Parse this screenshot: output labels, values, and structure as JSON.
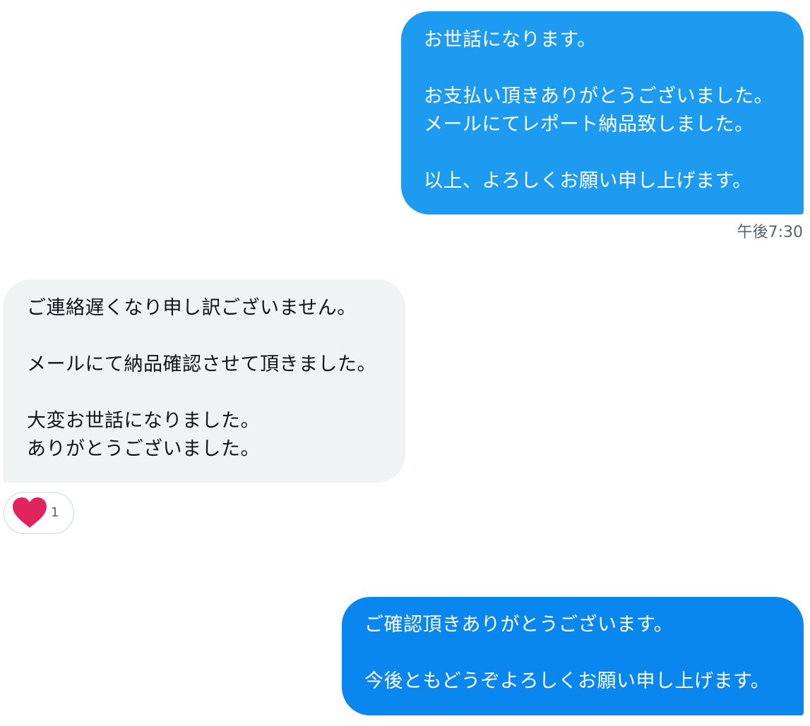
{
  "messages": [
    {
      "direction": "sent",
      "lines": [
        "お世話になります。",
        "お支払い頂きありがとうございました。",
        "メールにてレポート納品致しました。",
        "以上、よろしくお願い申し上げます。"
      ],
      "time": "午後7:30"
    },
    {
      "direction": "received",
      "lines": [
        "ご連絡遅くなり申し訳ございません。",
        "メールにて納品確認させて頂きました。",
        "大変お世話になりました。",
        "ありがとうございました。"
      ],
      "reaction": {
        "icon": "heart-icon",
        "color": "#e0245e",
        "count": "1"
      }
    },
    {
      "direction": "sent",
      "lines": [
        "ご確認頂きありがとうございます。",
        "今後ともどうぞよろしくお願い申し上げます。"
      ]
    }
  ],
  "colors": {
    "sent_bubble": "#1d9bf0",
    "sent_bubble_latest": "#0a86ef",
    "received_bubble": "#eff3f4",
    "timestamp": "#536471"
  }
}
